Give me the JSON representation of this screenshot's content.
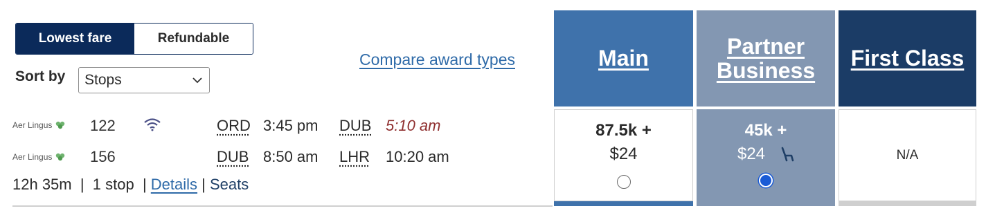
{
  "fare_toggle": {
    "lowest": "Lowest fare",
    "refundable": "Refundable"
  },
  "sort": {
    "label": "Sort by",
    "value": "Stops"
  },
  "compare_link": "Compare award types",
  "segments": [
    {
      "airline": "Aer Lingus",
      "flight": "122",
      "wifi": true,
      "from": "ORD",
      "depart": "3:45 pm",
      "to": "DUB",
      "arrive": "5:10 am"
    },
    {
      "airline": "Aer Lingus",
      "flight": "156",
      "wifi": false,
      "from": "DUB",
      "depart": "8:50 am",
      "to": "LHR",
      "arrive": "10:20 am"
    }
  ],
  "summary": {
    "duration": "12h 35m",
    "stops": "1 stop",
    "details": "Details",
    "seats": "Seats"
  },
  "cabins": {
    "main": {
      "title": "Main",
      "miles": "87.5k +",
      "tax": "$24",
      "selected": false
    },
    "partner": {
      "title_line1": "Partner",
      "title_line2": "Business",
      "miles": "45k +",
      "tax": "$24",
      "selected": true
    },
    "first": {
      "title": "First Class",
      "value": "N/A"
    }
  },
  "colors": {
    "main": "#3f72ab",
    "partner": "#8397b2",
    "first": "#1b3c66"
  }
}
